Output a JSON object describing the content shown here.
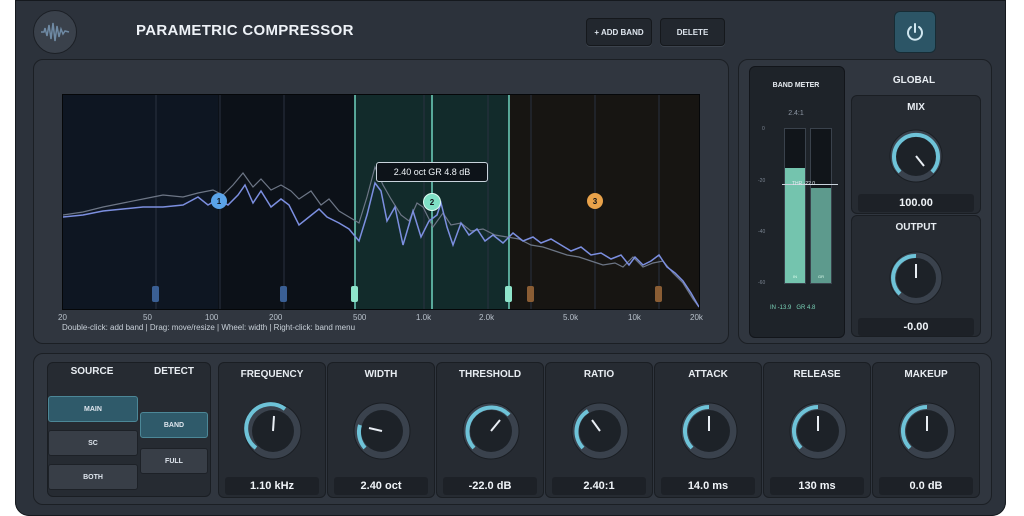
{
  "header": {
    "title": "PARAMETRIC COMPRESSOR",
    "add_band_label": "+ ADD BAND",
    "delete_label": "DELETE"
  },
  "graph": {
    "freq_labels": [
      "20",
      "50",
      "100",
      "200",
      "500",
      "1.0k",
      "2.0k",
      "5.0k",
      "10k",
      "20k"
    ],
    "hint": "Double-click: add band   |   Drag: move/resize   |   Wheel: width   |   Right-click: band menu",
    "tooltip": "2.40 oct   GR 4.8 dB",
    "bands": [
      {
        "label": "1",
        "color": "#5aa3e8"
      },
      {
        "label": "2",
        "color": "#7fe0c6"
      },
      {
        "label": "3",
        "color": "#e9a24a"
      }
    ]
  },
  "meter": {
    "title": "BAND METER",
    "ratio": "2.4:1",
    "scale": [
      "0",
      "-20",
      "-40",
      "-60"
    ],
    "threshold_label": "THR -22.0",
    "bar_labels": [
      "IN",
      "GR"
    ],
    "readout": "IN -13.9   GR 4.8",
    "in_level": 0.75,
    "gr_level": 0.62
  },
  "global": {
    "title": "GLOBAL",
    "mix": {
      "label": "MIX",
      "value": "100.00"
    },
    "output": {
      "label": "OUTPUT",
      "value": "-0.00"
    }
  },
  "source": {
    "title": "SOURCE",
    "buttons": [
      "MAIN",
      "SC",
      "BOTH"
    ],
    "selected": "MAIN"
  },
  "detect": {
    "title": "DETECT",
    "buttons": [
      "BAND",
      "FULL"
    ],
    "selected": "BAND"
  },
  "params": [
    {
      "label": "FREQUENCY",
      "value": "1.10 kHz"
    },
    {
      "label": "WIDTH",
      "value": "2.40 oct"
    },
    {
      "label": "THRESHOLD",
      "value": "-22.0 dB"
    },
    {
      "label": "RATIO",
      "value": "2.40:1"
    },
    {
      "label": "ATTACK",
      "value": "14.0 ms"
    },
    {
      "label": "RELEASE",
      "value": "130 ms"
    },
    {
      "label": "MAKEUP",
      "value": "0.0 dB"
    }
  ],
  "colors": {
    "accent": "#6ec3d8",
    "panel": "#30363f",
    "band_fill": "#1b4a4a"
  }
}
